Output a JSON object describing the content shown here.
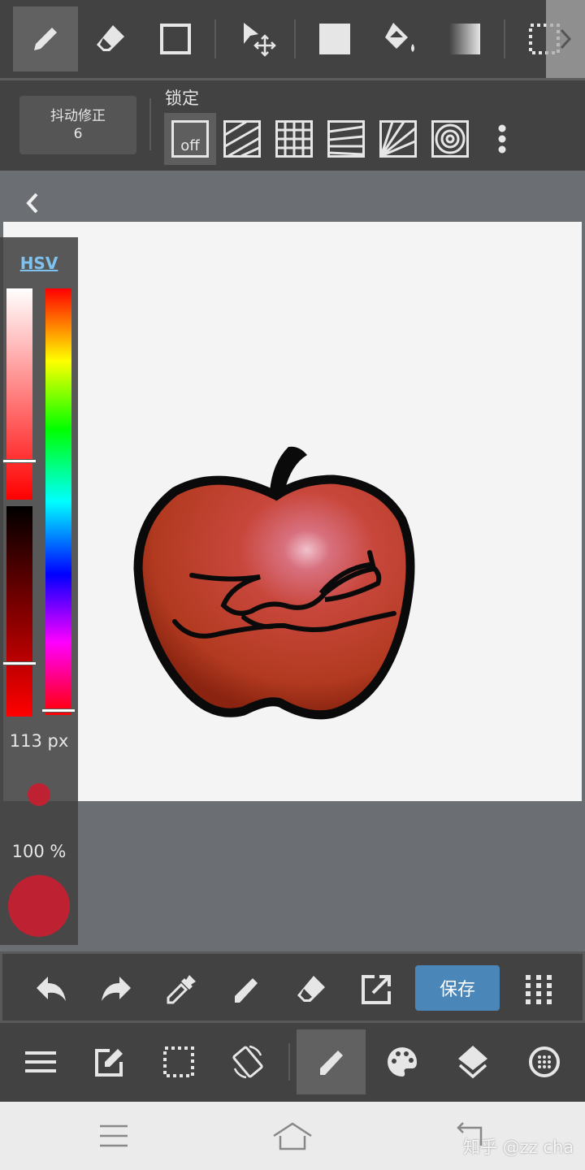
{
  "top_toolbar": {
    "tools": [
      "pen-icon",
      "eraser-icon",
      "rectangle-icon",
      "move-icon",
      "fill-rect-icon",
      "bucket-icon",
      "gradient-icon",
      "selection-icon"
    ],
    "active": "pen-icon"
  },
  "sub_toolbar": {
    "stabilizer_label": "抖动修正",
    "stabilizer_value": "6",
    "snap_label": "锁定",
    "snap_off_label": "off",
    "snap_modes": [
      "off",
      "parallel",
      "grid",
      "perspective",
      "radial",
      "circle"
    ]
  },
  "color_panel": {
    "mode_label": "HSV",
    "saturation": 0.82,
    "value": 0.75,
    "hue": 0.99,
    "brush_size": "113 px",
    "opacity": "100 %",
    "current_color": "#be2232"
  },
  "bottom_toolbar": {
    "save_label": "保存",
    "tools": [
      "undo-icon",
      "redo-icon",
      "eyedropper-icon",
      "pen-icon",
      "eraser-icon",
      "export-icon",
      "grid-menu-icon"
    ]
  },
  "bottom_nav": {
    "items": [
      "menu-icon",
      "edit-icon",
      "selection-icon",
      "rotate-icon",
      "pen-icon",
      "palette-icon",
      "layers-icon",
      "material-icon"
    ],
    "active": "pen-icon"
  },
  "watermark": "知乎 @zz cha",
  "colors": {
    "toolbar": "#424242",
    "accent": "#4a86b8",
    "canvas_bg": "#6b6e72"
  }
}
